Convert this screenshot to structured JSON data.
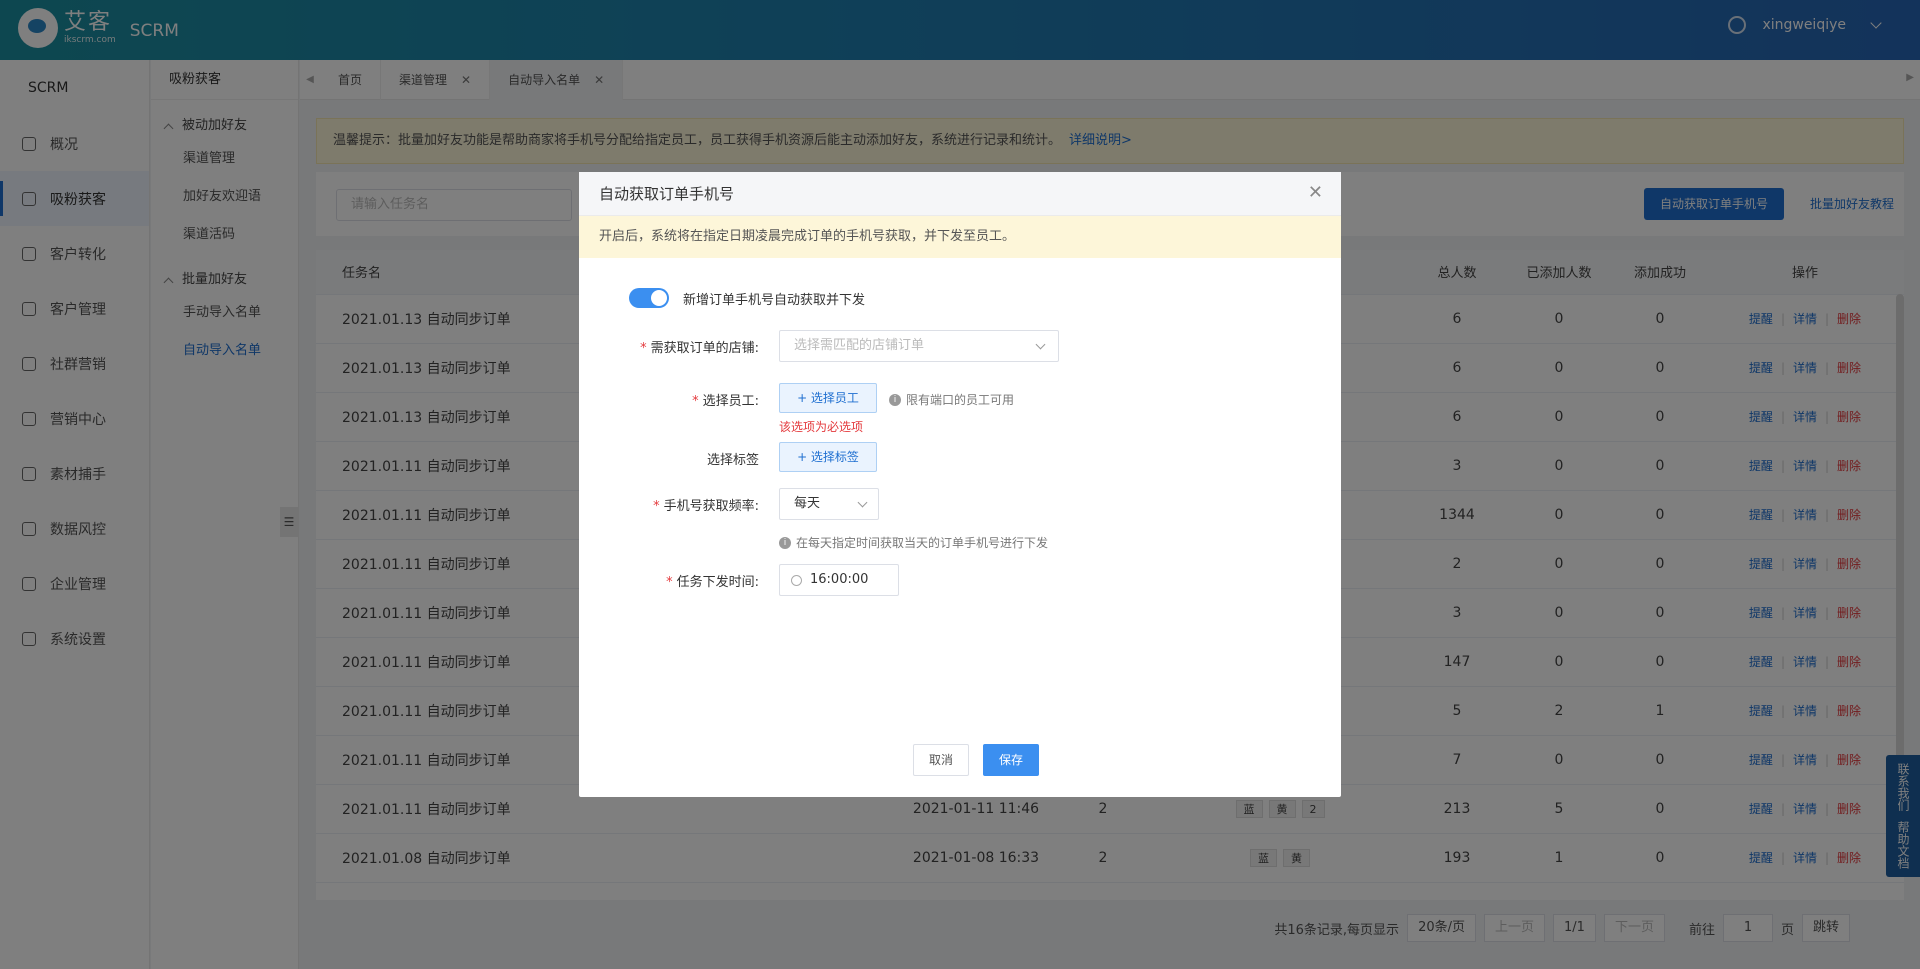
{
  "header": {
    "logo_cn": "艾客",
    "logo_en": "ikscrm.com",
    "product": "SCRM",
    "username": "xingweiqiye"
  },
  "sidenav": {
    "title": "SCRM",
    "items": [
      "概况",
      "吸粉获客",
      "客户转化",
      "客户管理",
      "社群营销",
      "营销中心",
      "素材捕手",
      "数据风控",
      "企业管理",
      "系统设置"
    ]
  },
  "subnav": {
    "title": "吸粉获客",
    "group1": "被动加好友",
    "group1_items": [
      "渠道管理",
      "加好友欢迎语",
      "渠道活码"
    ],
    "group2": "批量加好友",
    "group2_items": [
      "手动导入名单",
      "自动导入名单"
    ]
  },
  "tabs": [
    "首页",
    "渠道管理",
    "自动导入名单"
  ],
  "tip": {
    "text": "温馨提示：批量加好友功能是帮助商家将手机号分配给指定员工，员工获得手机资源后能主动添加好友，系统进行记录和统计。",
    "link": "详细说明>"
  },
  "filter": {
    "task_placeholder": "请输入任务名",
    "auto_button": "自动获取订单手机号",
    "tutorial": "批量加好友教程"
  },
  "table": {
    "headers": [
      "任务名",
      "总人数",
      "已添加人数",
      "添加成功",
      "操作"
    ],
    "ops": [
      "提醒",
      "详情",
      "删除"
    ],
    "rows": [
      {
        "name": "2021.01.13 自动同步订单",
        "time": "",
        "num": "",
        "tags": [],
        "total": "6",
        "added": "0",
        "success": "0"
      },
      {
        "name": "2021.01.13 自动同步订单",
        "time": "",
        "num": "",
        "tags": [],
        "total": "6",
        "added": "0",
        "success": "0"
      },
      {
        "name": "2021.01.13 自动同步订单",
        "time": "",
        "num": "",
        "tags": [],
        "total": "6",
        "added": "0",
        "success": "0"
      },
      {
        "name": "2021.01.11 自动同步订单",
        "time": "",
        "num": "",
        "tags": [],
        "total": "3",
        "added": "0",
        "success": "0"
      },
      {
        "name": "2021.01.11 自动同步订单",
        "time": "",
        "num": "",
        "tags": [],
        "total": "1344",
        "added": "0",
        "success": "0"
      },
      {
        "name": "2021.01.11 自动同步订单",
        "time": "",
        "num": "",
        "tags": [],
        "total": "2",
        "added": "0",
        "success": "0"
      },
      {
        "name": "2021.01.11 自动同步订单",
        "time": "",
        "num": "",
        "tags": [],
        "total": "3",
        "added": "0",
        "success": "0"
      },
      {
        "name": "2021.01.11 自动同步订单",
        "time": "",
        "num": "",
        "tags": [],
        "total": "147",
        "added": "0",
        "success": "0"
      },
      {
        "name": "2021.01.11 自动同步订单",
        "time": "",
        "num": "",
        "tags": [],
        "total": "5",
        "added": "2",
        "success": "1"
      },
      {
        "name": "2021.01.11 自动同步订单",
        "time": "",
        "num": "",
        "tags": [],
        "total": "7",
        "added": "0",
        "success": "0"
      },
      {
        "name": "2021.01.11 自动同步订单",
        "time": "2021-01-11 11:46",
        "num": "2",
        "tags": [
          "蓝",
          "黄",
          "2"
        ],
        "total": "213",
        "added": "5",
        "success": "0"
      },
      {
        "name": "2021.01.08 自动同步订单",
        "time": "2021-01-08 16:33",
        "num": "2",
        "tags": [
          "蓝",
          "黄"
        ],
        "total": "193",
        "added": "1",
        "success": "0"
      }
    ]
  },
  "pager": {
    "summary": "共16条记录,每页显示",
    "page_size": "20条/页",
    "prev": "上一页",
    "pages": "1/1",
    "next": "下一页",
    "goto": "前往",
    "page_input": "1",
    "page_unit": "页",
    "jump": "跳转"
  },
  "side_float": {
    "contact": "联系我们",
    "help": "帮助文档"
  },
  "modal": {
    "title": "自动获取订单手机号",
    "tip": "开启后，系统将在指定日期凌晨完成订单的手机号获取，并下发至员工。",
    "switch_label": "新增订单手机号自动获取并下发",
    "switch_on": true,
    "shop_label": "需获取订单的店铺:",
    "shop_placeholder": "选择需匹配的店铺订单",
    "staff_label": "选择员工:",
    "staff_button": "+ 选择员工",
    "staff_hint": "限有端口的员工可用",
    "staff_error": "该选项为必选项",
    "tag_label": "选择标签",
    "tag_button": "+ 选择标签",
    "freq_label": "手机号获取频率:",
    "freq_value": "每天",
    "freq_hint": "在每天指定时间获取当天的订单手机号进行下发",
    "time_label": "任务下发时间:",
    "time_value": "16:00:00",
    "cancel": "取消",
    "save": "保存"
  }
}
